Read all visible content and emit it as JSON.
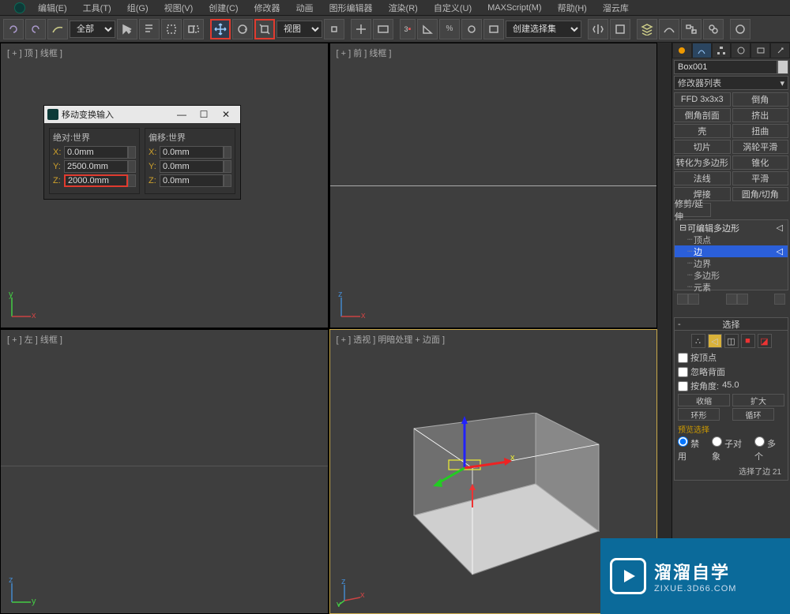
{
  "menubar": {
    "items": [
      "编辑(E)",
      "工具(T)",
      "组(G)",
      "视图(V)",
      "创建(C)",
      "修改器",
      "动画",
      "图形编辑器",
      "渲染(R)",
      "自定义(U)",
      "MAXScript(M)",
      "帮助(H)",
      "溜云库"
    ]
  },
  "toolbar": {
    "filter_dd": "全部",
    "view_dd": "视图",
    "selset_dd": "创建选择集"
  },
  "viewports": {
    "top": "[ + ] 顶 ] 线框 ]",
    "front": "[ + ] 前 ] 线框 ]",
    "left": "[ + ] 左 ] 线框 ]",
    "persp": "[ + ] 透视 ] 明暗处理 + 边面 ]"
  },
  "dialog": {
    "title": "移动变换输入",
    "group_abs": "绝对:世界",
    "group_off": "偏移:世界",
    "labels": {
      "x": "X:",
      "y": "Y:",
      "z": "Z:"
    },
    "abs": {
      "x": "0.0mm",
      "y": "2500.0mm",
      "z": "2000.0mm"
    },
    "off": {
      "x": "0.0mm",
      "y": "0.0mm",
      "z": "0.0mm"
    }
  },
  "panel": {
    "obj_name": "Box001",
    "mod_list_label": "修改器列表",
    "mod_buttons": [
      "FFD 3x3x3",
      "倒角",
      "倒角剖面",
      "挤出",
      "壳",
      "扭曲",
      "切片",
      "涡轮平滑",
      "转化为多边形",
      "锥化",
      "法线",
      "平滑",
      "焊接",
      "圆角/切角"
    ],
    "mod_wide": "修剪/延伸",
    "stack": {
      "header": "可编辑多边形",
      "items": [
        "顶点",
        "边",
        "边界",
        "多边形",
        "元素"
      ],
      "selected": 1
    },
    "rollout": {
      "title": "选择",
      "by_vertex": "按顶点",
      "ignore_back": "忽略背面",
      "by_angle": "按角度:",
      "angle_val": "45.0",
      "shrink": "收缩",
      "grow": "扩大",
      "ring": "环形",
      "loop": "循环",
      "preview": "预览选择",
      "radios": [
        "禁用",
        "子对象",
        "多个"
      ],
      "status": "选择了边 21"
    }
  },
  "watermark": {
    "big": "溜溜自学",
    "small": "ZIXUE.3D66.COM"
  }
}
